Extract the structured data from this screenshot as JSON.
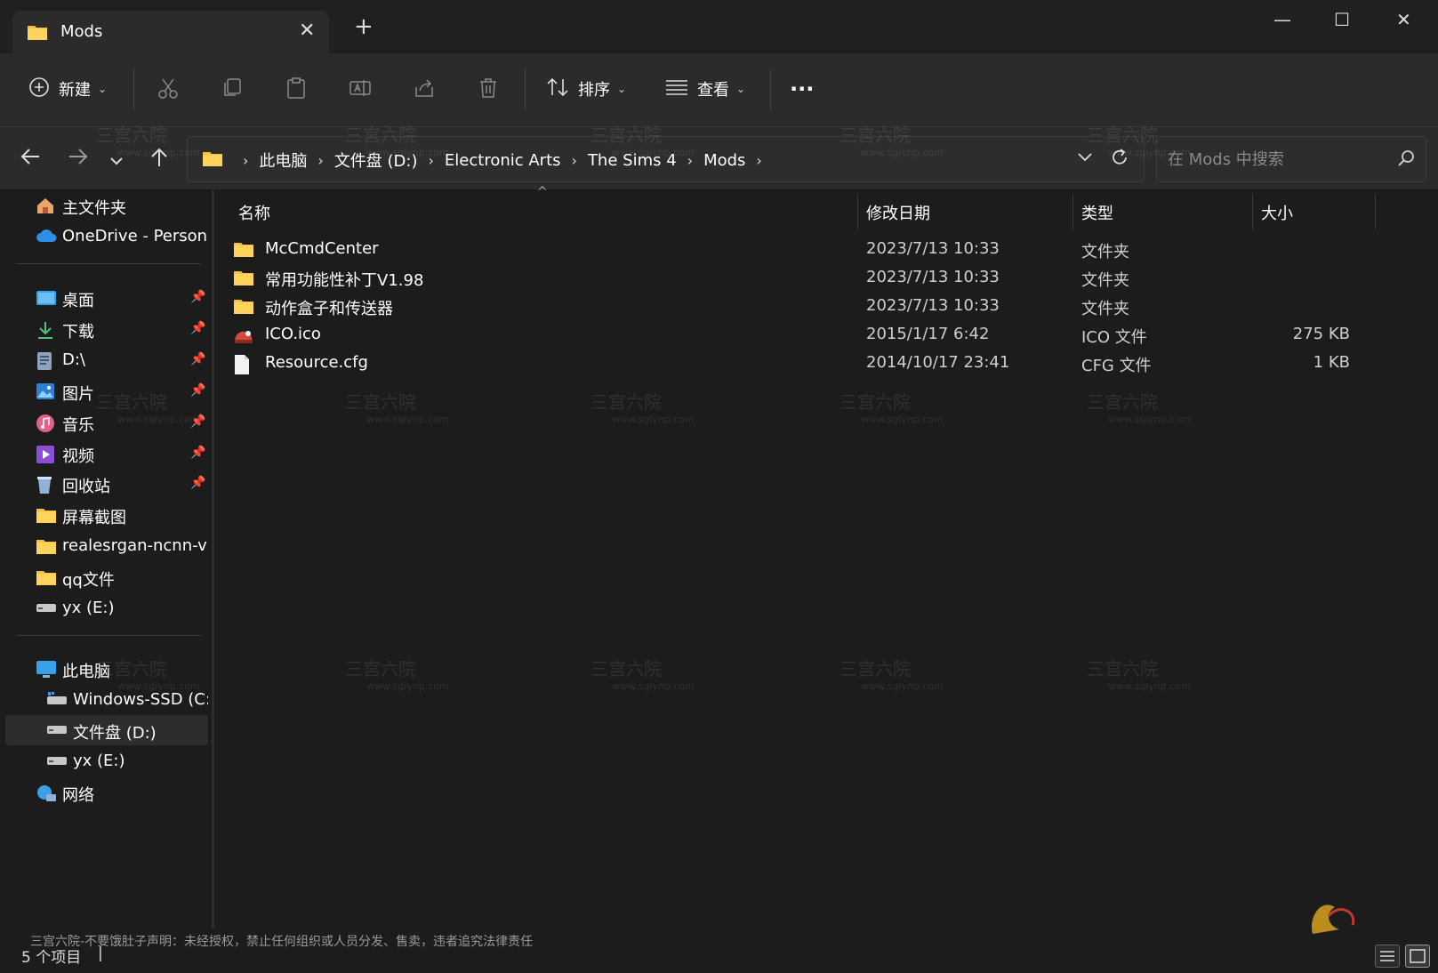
{
  "window": {
    "tab_title": "Mods",
    "new_tab": "+",
    "minimize": "—",
    "maximize": "☐",
    "close": "✕"
  },
  "toolbar": {
    "new_label": "新建",
    "sort_label": "排序",
    "view_label": "查看",
    "more_label": "···"
  },
  "address": {
    "crumbs": [
      "此电脑",
      "文件盘 (D:)",
      "Electronic Arts",
      "The Sims 4",
      "Mods"
    ],
    "search_placeholder": "在 Mods 中搜索"
  },
  "sidebar": {
    "items": [
      {
        "label": "主文件夹",
        "icon": "home-icon"
      },
      {
        "label": "OneDrive - Persona",
        "icon": "cloud-icon"
      },
      {
        "label": "桌面",
        "icon": "desktop-icon",
        "pinned": true
      },
      {
        "label": "下载",
        "icon": "download-icon",
        "pinned": true
      },
      {
        "label": "D:\\",
        "icon": "drive-doc-icon",
        "pinned": true
      },
      {
        "label": "图片",
        "icon": "pictures-icon",
        "pinned": true
      },
      {
        "label": "音乐",
        "icon": "music-icon",
        "pinned": true
      },
      {
        "label": "视频",
        "icon": "video-icon",
        "pinned": true
      },
      {
        "label": "回收站",
        "icon": "recycle-bin-icon",
        "pinned": true
      },
      {
        "label": "屏幕截图",
        "icon": "folder-icon"
      },
      {
        "label": "realesrgan-ncnn-vu",
        "icon": "folder-icon"
      },
      {
        "label": "qq文件",
        "icon": "folder-icon"
      },
      {
        "label": "yx (E:)",
        "icon": "drive-icon"
      },
      {
        "label": "此电脑",
        "icon": "computer-icon"
      },
      {
        "label": "Windows-SSD (C:)",
        "icon": "drive-ssd-icon"
      },
      {
        "label": "文件盘 (D:)",
        "icon": "drive-icon",
        "selected": true
      },
      {
        "label": "yx (E:)",
        "icon": "drive-icon"
      },
      {
        "label": "网络",
        "icon": "network-icon"
      }
    ],
    "pin_glyph": "📌"
  },
  "columns": {
    "name": "名称",
    "date": "修改日期",
    "type": "类型",
    "size": "大小"
  },
  "files": [
    {
      "name": "McCmdCenter",
      "date": "2023/7/13 10:33",
      "type": "文件夹",
      "size": "",
      "icon": "folder-icon"
    },
    {
      "name": "常用功能性补丁V1.98",
      "date": "2023/7/13 10:33",
      "type": "文件夹",
      "size": "",
      "icon": "folder-icon"
    },
    {
      "name": "动作盒子和传送器",
      "date": "2023/7/13 10:33",
      "type": "文件夹",
      "size": "",
      "icon": "folder-icon"
    },
    {
      "name": "ICO.ico",
      "date": "2015/1/17 6:42",
      "type": "ICO 文件",
      "size": "275 KB",
      "icon": "ico-file-icon"
    },
    {
      "name": "Resource.cfg",
      "date": "2014/10/17 23:41",
      "type": "CFG 文件",
      "size": "1 KB",
      "icon": "file-icon"
    }
  ],
  "status": {
    "count": "5 个项目",
    "caret": "|",
    "disclaimer": "三宫六院-不要饿肚子声明：未经授权，禁止任何组织或人员分发、售卖，违者追究法律责任"
  },
  "watermark": {
    "text": "三宫六院",
    "url": "www.sglynp.com"
  },
  "colors": {
    "folder": "#f5c242",
    "accent": "#4cc2ff",
    "background": "#1c1c1c",
    "toolbar": "#2b2b2b"
  }
}
